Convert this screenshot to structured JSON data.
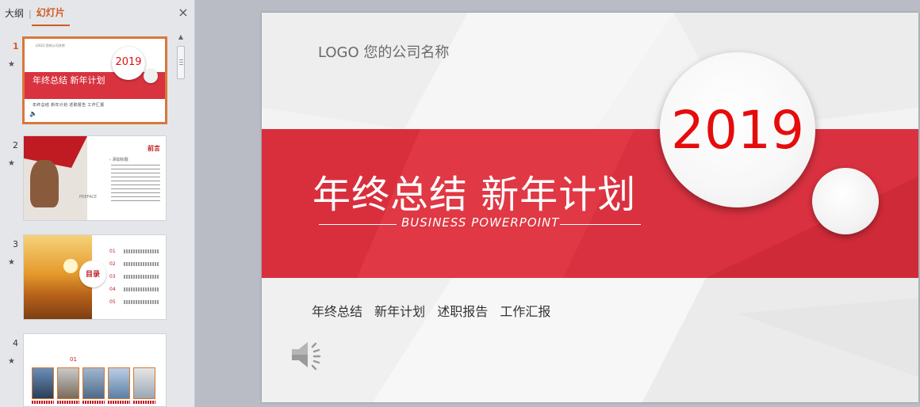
{
  "panel": {
    "tabs": [
      "大纲",
      "幻灯片"
    ],
    "separator": "|",
    "close_glyph": "×"
  },
  "thumbnails": [
    {
      "number": "1",
      "star": "★",
      "logo": "LOGO 您的公司名称",
      "year": "2019",
      "title": "年终总结 新年计划",
      "subtitle": "年终总结 新年计划 述职报告 工作汇报",
      "speaker": "🔈"
    },
    {
      "number": "2",
      "star": "★",
      "badge": "前言",
      "heading": "› 添加标题",
      "preface": "PREFACE"
    },
    {
      "number": "3",
      "star": "★",
      "label": "目录",
      "items": [
        "01",
        "02",
        "03",
        "04",
        "05"
      ]
    },
    {
      "number": "4",
      "star": "★",
      "num": "01"
    }
  ],
  "slide": {
    "logo_text": "LOGO 您的公司名称",
    "year": "2019",
    "title": "年终总结 新年计划",
    "subtitle": "BUSINESS POWERPOINT",
    "tagline": [
      "年终总结",
      "新年计划",
      "述职报告",
      "工作汇报"
    ]
  },
  "colors": {
    "accent": "#dc3341",
    "year_red": "#e60c0c",
    "selection_orange": "#d9773a",
    "tab_active": "#d25a22"
  }
}
